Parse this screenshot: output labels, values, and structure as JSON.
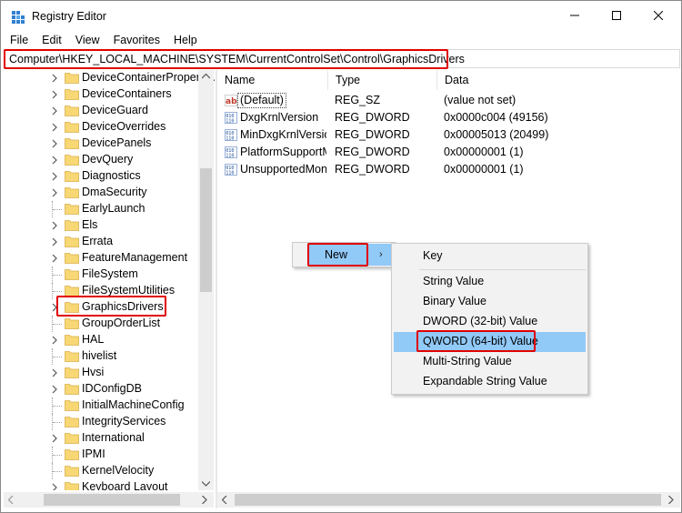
{
  "window": {
    "title": "Registry Editor",
    "icon": "registry-editor-icon"
  },
  "menu": [
    "File",
    "Edit",
    "View",
    "Favorites",
    "Help"
  ],
  "address": "Computer\\HKEY_LOCAL_MACHINE\\SYSTEM\\CurrentControlSet\\Control\\GraphicsDrivers",
  "tree": {
    "items": [
      {
        "label": "DeviceContainerPropertyUpdateEvents",
        "expandable": true
      },
      {
        "label": "DeviceContainers",
        "expandable": true
      },
      {
        "label": "DeviceGuard",
        "expandable": true
      },
      {
        "label": "DeviceOverrides",
        "expandable": true
      },
      {
        "label": "DevicePanels",
        "expandable": true
      },
      {
        "label": "DevQuery",
        "expandable": true
      },
      {
        "label": "Diagnostics",
        "expandable": true
      },
      {
        "label": "DmaSecurity",
        "expandable": true
      },
      {
        "label": "EarlyLaunch",
        "expandable": false
      },
      {
        "label": "Els",
        "expandable": true
      },
      {
        "label": "Errata",
        "expandable": true
      },
      {
        "label": "FeatureManagement",
        "expandable": true
      },
      {
        "label": "FileSystem",
        "expandable": false
      },
      {
        "label": "FileSystemUtilities",
        "expandable": false
      },
      {
        "label": "GraphicsDrivers",
        "expandable": true,
        "selected": true
      },
      {
        "label": "GroupOrderList",
        "expandable": false
      },
      {
        "label": "HAL",
        "expandable": true
      },
      {
        "label": "hivelist",
        "expandable": false
      },
      {
        "label": "Hvsi",
        "expandable": true
      },
      {
        "label": "IDConfigDB",
        "expandable": true
      },
      {
        "label": "InitialMachineConfig",
        "expandable": false
      },
      {
        "label": "IntegrityServices",
        "expandable": false
      },
      {
        "label": "International",
        "expandable": true
      },
      {
        "label": "IPMI",
        "expandable": false
      },
      {
        "label": "KernelVelocity",
        "expandable": false
      },
      {
        "label": "Keyboard Layout",
        "expandable": true
      }
    ]
  },
  "list": {
    "columns": {
      "name": "Name",
      "type": "Type",
      "data": "Data"
    },
    "rows": [
      {
        "name": "(Default)",
        "type": "REG_SZ",
        "data": "(value not set)",
        "icon": "string-value-icon"
      },
      {
        "name": "DxgKrnlVersion",
        "type": "REG_DWORD",
        "data": "0x0000c004 (49156)",
        "icon": "binary-value-icon"
      },
      {
        "name": "MinDxgKrnlVersion",
        "type": "REG_DWORD",
        "data": "0x00005013 (20499)",
        "icon": "binary-value-icon"
      },
      {
        "name": "PlatformSupportMiracast",
        "type": "REG_DWORD",
        "data": "0x00000001 (1)",
        "icon": "binary-value-icon"
      },
      {
        "name": "UnsupportedMonitorModesAllowed",
        "type": "REG_DWORD",
        "data": "0x00000001 (1)",
        "icon": "binary-value-icon"
      }
    ]
  },
  "context_menu": {
    "new_label": "New",
    "new_arrow": "›",
    "submenu": [
      "Key",
      "String Value",
      "Binary Value",
      "DWORD (32-bit) Value",
      "QWORD (64-bit) Value",
      "Multi-String Value",
      "Expandable String Value"
    ],
    "hovered": "QWORD (64-bit) Value"
  },
  "colors": {
    "highlight_red": "#e00000",
    "hover_blue": "#91c9f7",
    "folder_yellow": "#f8d775"
  }
}
